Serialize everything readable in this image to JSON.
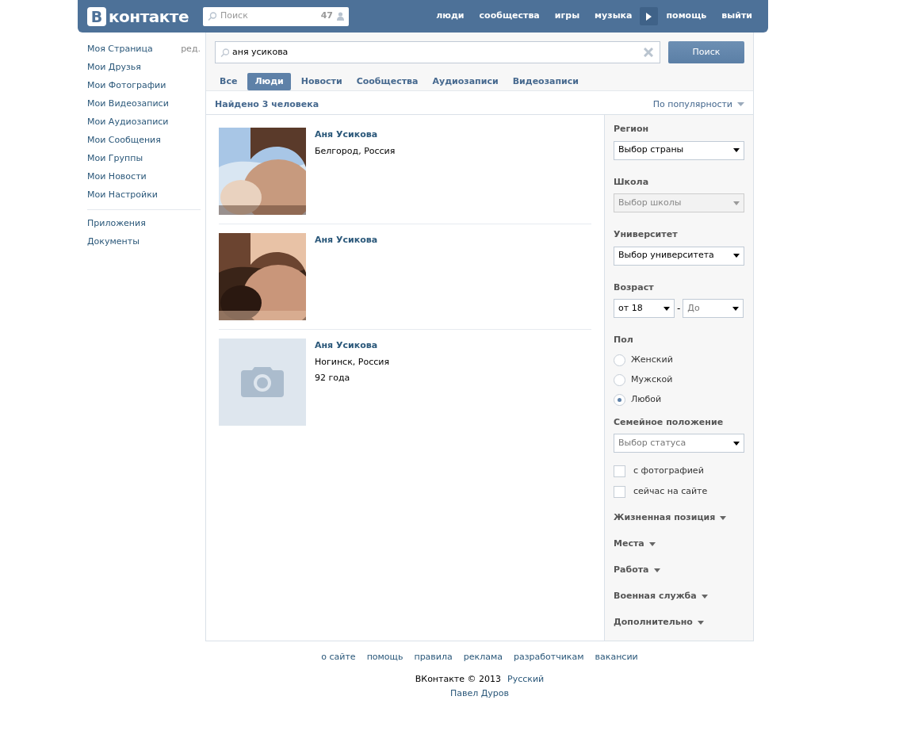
{
  "header": {
    "logo_letter": "В",
    "logo_text": "контакте",
    "search": {
      "placeholder": "Поиск",
      "count": "47"
    },
    "nav": [
      {
        "label": "люди"
      },
      {
        "label": "сообщества"
      },
      {
        "label": "игры"
      },
      {
        "label": "музыка"
      },
      {
        "kind": "player"
      },
      {
        "label": "помощь"
      },
      {
        "label": "выйти"
      }
    ]
  },
  "sidebar": {
    "edit_link": "ред.",
    "groups": [
      [
        "Моя Страница",
        "Мои Друзья",
        "Мои Фотографии",
        "Мои Видеозаписи",
        "Мои Аудиозаписи",
        "Мои Сообщения",
        "Мои Группы",
        "Мои Новости",
        "Мои Настройки"
      ],
      [
        "Приложения",
        "Документы"
      ]
    ]
  },
  "search": {
    "value": "аня усикова",
    "button": "Поиск",
    "tabs": [
      {
        "label": "Все",
        "selected": false
      },
      {
        "label": "Люди",
        "selected": true
      },
      {
        "label": "Новости",
        "selected": false
      },
      {
        "label": "Сообщества",
        "selected": false
      },
      {
        "label": "Аудиозаписи",
        "selected": false
      },
      {
        "label": "Видеозаписи",
        "selected": false
      }
    ]
  },
  "results": {
    "summary": "Найдено 3 человека",
    "sort": "По популярности",
    "people": [
      {
        "kind": "picture",
        "name": "Аня Усикова",
        "lines": [
          "Белгород, Россия"
        ]
      },
      {
        "kind": "picture",
        "name": "Аня Усикова"
      },
      {
        "kind": "no_photo",
        "name": "Аня Усикова",
        "lines": [
          "Ногинск, Россия",
          "92 года"
        ]
      }
    ]
  },
  "filters": [
    {
      "kind": "select",
      "label": "Регион",
      "value": "Выбор страны",
      "disabled": false
    },
    {
      "kind": "select",
      "label": "Школа",
      "placeholder": "Выбор школы",
      "disabled": true
    },
    {
      "kind": "select",
      "label": "Университет",
      "value": "Выбор университета",
      "disabled": false
    },
    {
      "kind": "range",
      "label": "Возраст",
      "from": {
        "value": "от 18"
      },
      "separator": "-",
      "to": {
        "placeholder": "До"
      }
    },
    {
      "kind": "radio",
      "label": "Пол",
      "options": [
        {
          "label": "Женский",
          "selected": false
        },
        {
          "label": "Мужской",
          "selected": false
        },
        {
          "label": "Любой",
          "selected": true
        }
      ]
    },
    {
      "kind": "select",
      "label": "Семейное положение",
      "placeholder": "Выбор статуса",
      "disabled": false
    },
    {
      "kind": "checkbox",
      "label": "с фотографией",
      "checked": false
    },
    {
      "kind": "checkbox",
      "label": "сейчас на сайте",
      "checked": false
    },
    {
      "kind": "expander",
      "label": "Жизненная позиция",
      "expanded": false
    },
    {
      "kind": "expander",
      "label": "Места",
      "expanded": false
    },
    {
      "kind": "expander",
      "label": "Работа",
      "expanded": false
    },
    {
      "kind": "expander",
      "label": "Военная служба",
      "expanded": false
    },
    {
      "kind": "expander",
      "label": "Дополнительно",
      "expanded": false
    }
  ],
  "footer": {
    "links": [
      "о сайте",
      "помощь",
      "правила",
      "реклама",
      "разработчикам",
      "вакансии"
    ],
    "copyright": "ВКонтакте © 2013",
    "language": "Русский",
    "author": "Павел Дуров"
  }
}
